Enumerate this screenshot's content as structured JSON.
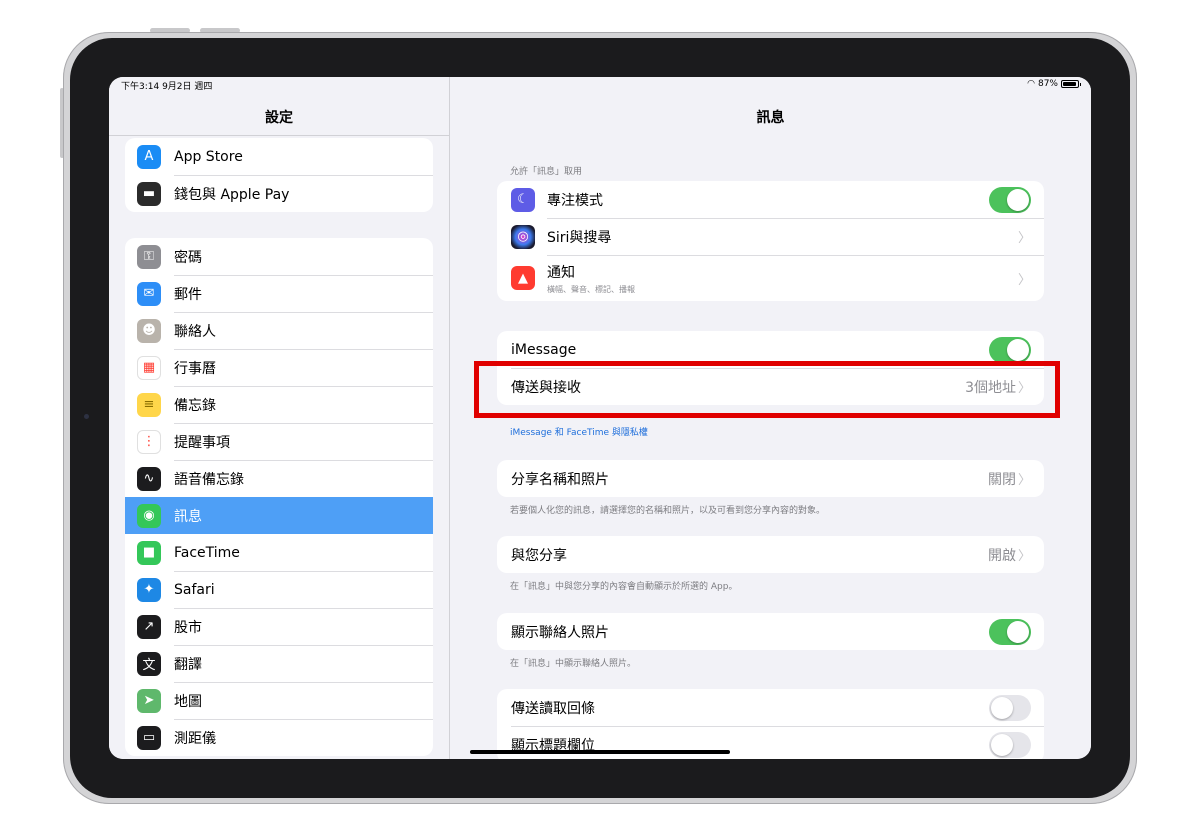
{
  "status_bar": {
    "time": "下午3:14  9月2日 週四",
    "battery": "87%"
  },
  "sidebar": {
    "title": "設定",
    "group1": [
      {
        "label": "App Store",
        "icon": "app-store-icon",
        "color": "#1a8cf5",
        "glyph": "A"
      },
      {
        "label": "錢包與 Apple Pay",
        "icon": "wallet-icon",
        "color": "#2b2b2b",
        "glyph": "▬"
      }
    ],
    "group2": [
      {
        "label": "密碼",
        "icon": "key-icon",
        "color": "#8e8e93",
        "glyph": "⚿"
      },
      {
        "label": "郵件",
        "icon": "mail-icon",
        "color": "#2d8ef7",
        "glyph": "✉"
      },
      {
        "label": "聯絡人",
        "icon": "contacts-icon",
        "color": "#b9b3ab",
        "glyph": "☻"
      },
      {
        "label": "行事曆",
        "icon": "calendar-icon",
        "color": "#ffffff",
        "glyph": "▦"
      },
      {
        "label": "備忘錄",
        "icon": "notes-icon",
        "color": "#ffd64a",
        "glyph": "≡"
      },
      {
        "label": "提醒事項",
        "icon": "reminders-icon",
        "color": "#ffffff",
        "glyph": "⋮"
      },
      {
        "label": "語音備忘錄",
        "icon": "voice-memos-icon",
        "color": "#1c1c1e",
        "glyph": "∿"
      },
      {
        "label": "訊息",
        "icon": "messages-icon",
        "color": "#34c759",
        "glyph": "◉"
      },
      {
        "label": "FaceTime",
        "icon": "facetime-icon",
        "color": "#34c759",
        "glyph": "■"
      },
      {
        "label": "Safari",
        "icon": "safari-icon",
        "color": "#1e88e5",
        "glyph": "✦"
      },
      {
        "label": "股市",
        "icon": "stocks-icon",
        "color": "#1c1c1e",
        "glyph": "↗"
      },
      {
        "label": "翻譯",
        "icon": "translate-icon",
        "color": "#1c1c1e",
        "glyph": "文"
      },
      {
        "label": "地圖",
        "icon": "maps-icon",
        "color": "#5fb86c",
        "glyph": "➤"
      },
      {
        "label": "測距儀",
        "icon": "measure-icon",
        "color": "#1c1c1e",
        "glyph": "▭"
      }
    ]
  },
  "detail": {
    "title": "訊息",
    "allow_header": "允許「訊息」取用",
    "focus": {
      "label": "專注模式",
      "icon": "moon-icon",
      "color": "#5e5ce6",
      "glyph": "☾",
      "toggle_on": true
    },
    "siri": {
      "label": "Siri與搜尋",
      "icon": "siri-icon",
      "color": "#2a1c4e",
      "glyph": "◎"
    },
    "notifications": {
      "label": "通知",
      "sub": "橫幅、聲音、標記、播報",
      "icon": "notification-icon",
      "color": "#ff3b30",
      "glyph": "🔔"
    },
    "imessage": {
      "label": "iMessage",
      "toggle_on": true
    },
    "send_receive": {
      "label": "傳送與接收",
      "value": "3個地址"
    },
    "imessage_link": "iMessage 和 FaceTime 與隱私權",
    "share_name": {
      "label": "分享名稱和照片",
      "value": "關閉",
      "footnote": "若要個人化您的訊息，請選擇您的名稱和照片，以及可看到您分享內容的對象。"
    },
    "shared_with_you": {
      "label": "與您分享",
      "value": "開啟",
      "footnote": "在「訊息」中與您分享的內容會自動顯示於所選的 App。"
    },
    "contact_photos": {
      "label": "顯示聯絡人照片",
      "toggle_on": true,
      "footnote": "在「訊息」中顯示聯絡人照片。"
    },
    "read_receipts": {
      "label": "傳送讀取回條",
      "toggle_on": false
    },
    "subject_field": {
      "label": "顯示標題欄位",
      "toggle_on": false
    }
  }
}
